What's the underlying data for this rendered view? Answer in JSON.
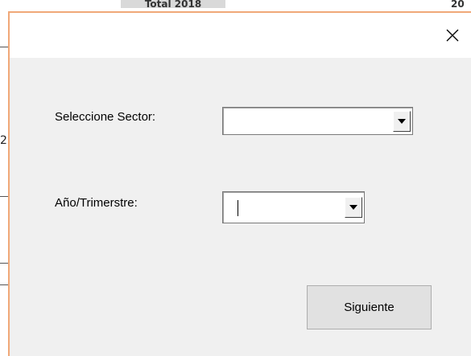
{
  "background_sheet": {
    "header_cell_text": "Total 2018",
    "corner_text": "20",
    "cell_digit": "2"
  },
  "dialog": {
    "close_icon": "close-icon",
    "fields": [
      {
        "label": "Seleccione Sector:",
        "value": ""
      },
      {
        "label": "Año/Trimerstre:",
        "value": ""
      }
    ],
    "dropdown_icon": "chevron-down-icon",
    "next_button_label": "Siguiente"
  },
  "colors": {
    "dialog_background": "#f0f0f0",
    "title_bar": "#ffffff",
    "window_border": "#f0a878",
    "button_background": "#e1e1e1"
  }
}
